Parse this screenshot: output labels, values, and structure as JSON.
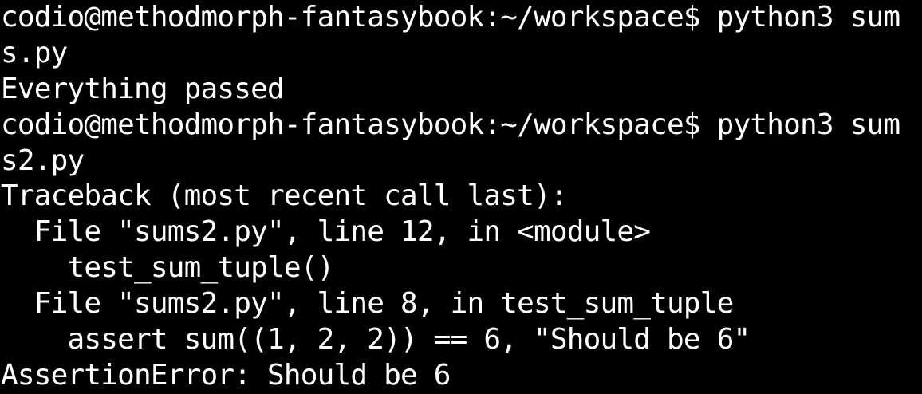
{
  "terminal": {
    "background_color": "#000000",
    "text_color": "#ffffff",
    "lines": [
      "codio@methodmorph-fantasybook:~/workspace$ python3 sum",
      "s.py",
      "Everything passed",
      "codio@methodmorph-fantasybook:~/workspace$ python3 sum",
      "s2.py",
      "Traceback (most recent call last):",
      "  File \"sums2.py\", line 12, in <module>",
      "    test_sum_tuple()",
      "  File \"sums2.py\", line 8, in test_sum_tuple",
      "    assert sum((1, 2, 2)) == 6, \"Should be 6\"",
      "AssertionError: Should be 6"
    ]
  }
}
